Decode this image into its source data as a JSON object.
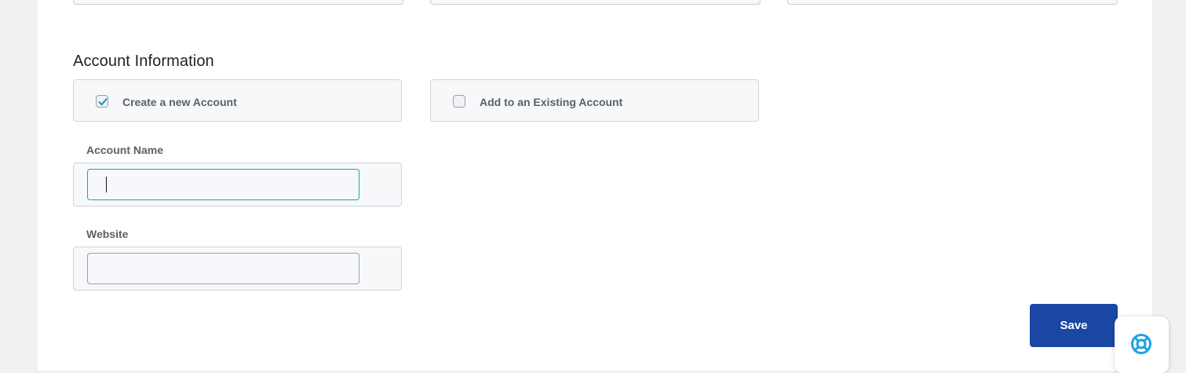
{
  "section": {
    "title": "Account Information"
  },
  "account_options": [
    {
      "label": "Create a new Account",
      "checked": true
    },
    {
      "label": "Add to an Existing Account",
      "checked": false
    }
  ],
  "fields": {
    "account_name": {
      "label": "Account Name",
      "value": "",
      "placeholder": ""
    },
    "website": {
      "label": "Website",
      "value": "",
      "placeholder": ""
    }
  },
  "actions": {
    "save_label": "Save"
  },
  "colors": {
    "primary": "#1a47a4",
    "focus": "#1aa3b8",
    "check": "#1a8fd6",
    "help_icon": "#1ea0e8"
  },
  "icons": {
    "help": "lifebuoy-icon",
    "check": "checkmark-icon"
  }
}
